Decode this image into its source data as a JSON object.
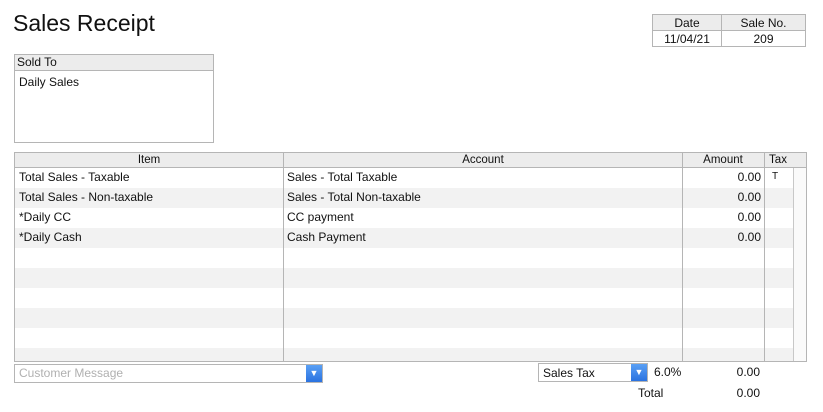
{
  "form": {
    "title": "Sales Receipt"
  },
  "meta": {
    "date_label": "Date",
    "sale_no_label": "Sale No.",
    "date": "11/04/21",
    "sale_no": "209"
  },
  "sold_to": {
    "label": "Sold To",
    "value": "Daily Sales"
  },
  "table": {
    "headers": {
      "item": "Item",
      "account": "Account",
      "amount": "Amount",
      "tax": "Tax"
    },
    "rows": [
      {
        "item": "Total Sales - Taxable",
        "account": "Sales - Total Taxable",
        "amount": "0.00",
        "tax": "T"
      },
      {
        "item": "Total Sales - Non-taxable",
        "account": "Sales - Total Non-taxable",
        "amount": "0.00",
        "tax": ""
      },
      {
        "item": "*Daily CC",
        "account": "CC payment",
        "amount": "0.00",
        "tax": ""
      },
      {
        "item": "*Daily Cash",
        "account": "Cash Payment",
        "amount": "0.00",
        "tax": ""
      }
    ]
  },
  "footer": {
    "customer_message_placeholder": "Customer Message",
    "sales_tax_item": "Sales Tax",
    "tax_rate": "6.0%",
    "tax_amount": "0.00",
    "total_label": "Total",
    "total_amount": "0.00"
  },
  "colors": {
    "header_bg": "#ececec",
    "border": "#b5b5b5",
    "dropdown_accent": "#2a72e0"
  },
  "icons": {
    "dropdown": "chevron-down-icon"
  }
}
